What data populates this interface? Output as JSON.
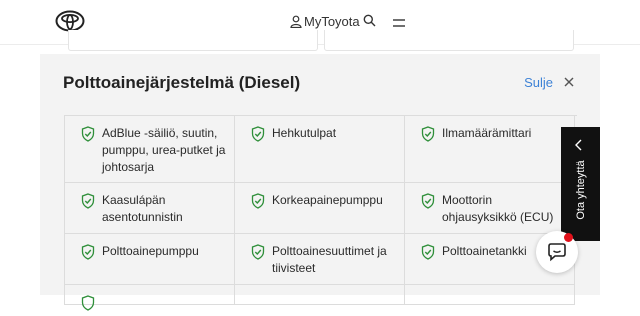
{
  "header": {
    "account_label": "MyToyota"
  },
  "panel": {
    "title": "Polttoainejärjestelmä (Diesel)",
    "close_label": "Sulje",
    "items": [
      [
        "AdBlue -säiliö, suutin, pumppu, urea-putket ja johtosarja",
        "Hehkutulpat",
        "Ilmamäärämittari"
      ],
      [
        "Kaasulápän asentotunnistin",
        "Korkeapainepumppu",
        "Moottorin ohjausyksikkö (ECU)"
      ],
      [
        "Polttoainepumppu",
        "Polttoainesuuttimet ja tiivisteet",
        "Polttoainetankki"
      ]
    ]
  },
  "contact_tab": {
    "label": "Ota yhteyttä"
  },
  "colors": {
    "accent_link": "#3d82d6",
    "check_icon": "#2f8f3a",
    "panel_bg": "#f3f3f3",
    "contact_tab_bg": "#111111",
    "chat_badge": "#e0101a"
  }
}
